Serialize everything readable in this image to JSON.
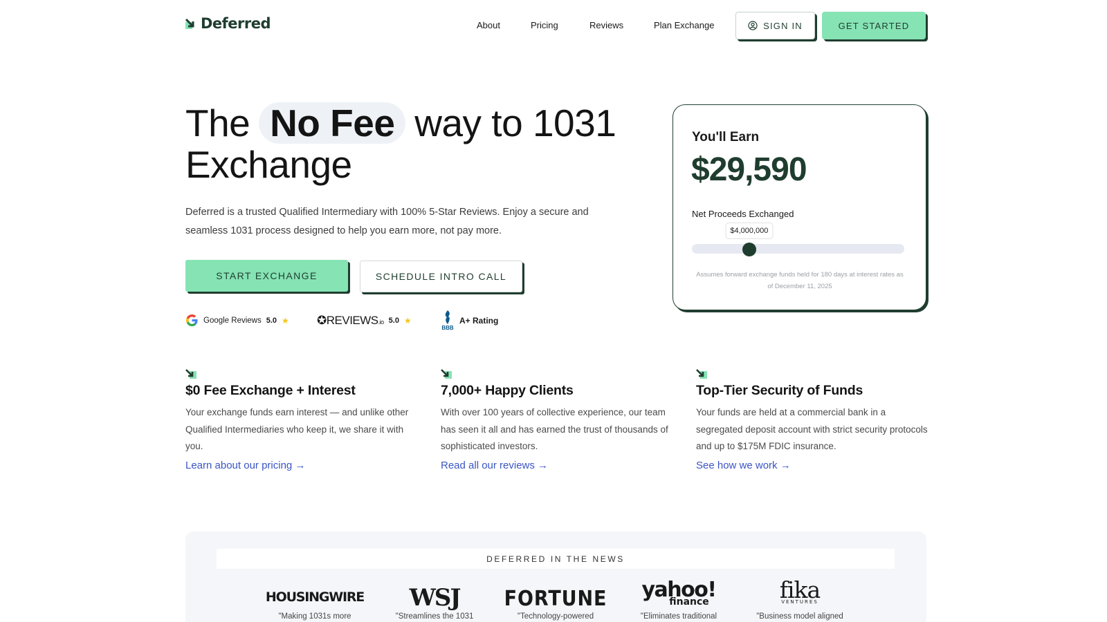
{
  "header": {
    "brand": "Deferred",
    "nav": [
      "About",
      "Pricing",
      "Reviews",
      "Plan Exchange"
    ],
    "sign_in": "SIGN IN",
    "get_started": "GET STARTED"
  },
  "hero": {
    "title_pre": "The",
    "title_highlight": "No Fee",
    "title_post": "way to 1031",
    "title_line2": "Exchange",
    "subtitle": "Deferred is a trusted Qualified Intermediary with 100% 5-Star Reviews. Enjoy a secure and seamless 1031 process designed to help you earn more, not pay more.",
    "start_button": "START EXCHANGE",
    "schedule_button": "SCHEDULE INTRO CALL"
  },
  "ratings": {
    "google_label": "Google Reviews",
    "google_score": "5.0",
    "reviewsio_brand": "REVIEWS",
    "reviewsio_suffix": ".io",
    "reviewsio_score": "5.0",
    "bbb_mark": "BBB",
    "bbb_label": "A+ Rating"
  },
  "earn_card": {
    "title": "You'll Earn",
    "amount": "$29,590",
    "slider_label": "Net Proceeds Exchanged",
    "slider_value": "$4,000,000",
    "slider_fraction": 0.27,
    "note": "Assumes forward exchange funds held for 180 days at interest rates as of December 11, 2025"
  },
  "features": [
    {
      "title": "$0 Fee Exchange + Interest",
      "desc": "Your exchange funds earn interest — and unlike other Qualified Intermediaries who keep it, we share it with you.",
      "link": "Learn about our pricing →"
    },
    {
      "title": "7,000+ Happy Clients",
      "desc": "With over 100 years of collective experience, our team has seen it all and has earned the trust of thousands of sophisticated investors.",
      "link": "Read all our reviews →"
    },
    {
      "title": "Top-Tier Security of Funds",
      "desc": "Your funds are held at a commercial bank in a segregated deposit account with strict security protocols and up to $175M FDIC insurance.",
      "link": "See how we work →"
    }
  ],
  "news": {
    "header": "DEFERRED IN THE NEWS",
    "outlets": [
      {
        "name": "HOUSINGWIRE",
        "quote": "\"Making 1031s more"
      },
      {
        "name": "WSJ",
        "quote": "\"Streamlines the 1031"
      },
      {
        "name": "FORTUNE",
        "quote": "\"Technology-powered"
      },
      {
        "name": "yahoo!",
        "sub": "finance",
        "quote": "\"Eliminates traditional"
      },
      {
        "name": "fika",
        "sub": "VENTURES",
        "quote": "\"Business model aligned"
      }
    ]
  },
  "colors": {
    "brand_dark": "#1f3d2f",
    "accent_green": "#86e3b4",
    "link_blue": "#3b55c4"
  }
}
